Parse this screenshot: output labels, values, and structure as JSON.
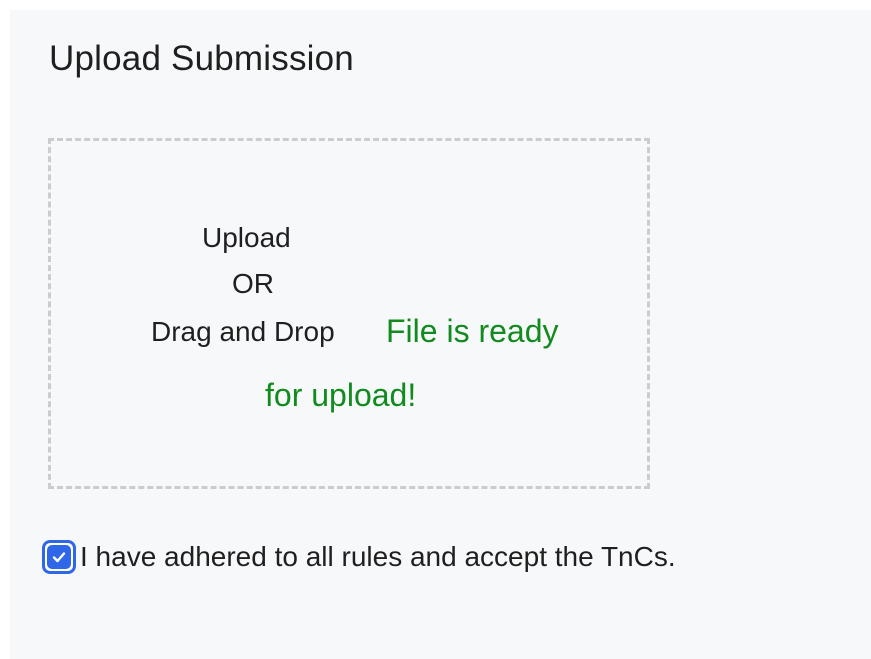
{
  "upload": {
    "title": "Upload Submission",
    "dropzone": {
      "line1": "Upload",
      "line2": "OR",
      "line3": "Drag and Drop",
      "status_line1": "File is ready",
      "status_line2": "for upload!",
      "status_color": "#118a1e"
    }
  },
  "consent": {
    "checked": true,
    "label": "I have adhered to all rules and accept the TnCs.",
    "accent_color": "#2f67e8"
  },
  "icons": {
    "checkbox": "checkmark-icon"
  }
}
